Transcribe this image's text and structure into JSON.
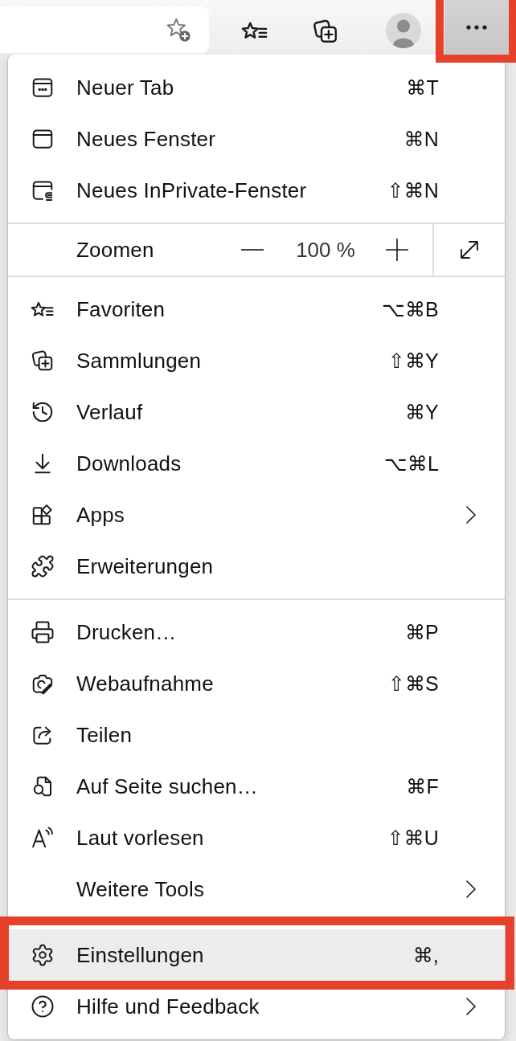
{
  "toolbar": {
    "more_button": {
      "pressed": true,
      "highlighted": true
    }
  },
  "menu": {
    "sections": [
      {
        "items": [
          {
            "kind": "command",
            "label": "Neuer Tab",
            "shortcut": "⌘T",
            "submenu": false,
            "selected": false,
            "highlighted": false
          },
          {
            "kind": "command",
            "label": "Neues Fenster",
            "shortcut": "⌘N",
            "submenu": false,
            "selected": false,
            "highlighted": false
          },
          {
            "kind": "command",
            "label": "Neues InPrivate-Fenster",
            "shortcut": "⇧⌘N",
            "submenu": false,
            "selected": false,
            "highlighted": false
          }
        ]
      },
      {
        "items": [
          {
            "kind": "zoom",
            "label": "Zoomen",
            "value": "100 %"
          }
        ]
      },
      {
        "items": [
          {
            "kind": "command",
            "label": "Favoriten",
            "shortcut": "⌥⌘B",
            "submenu": false,
            "selected": false,
            "highlighted": false
          },
          {
            "kind": "command",
            "label": "Sammlungen",
            "shortcut": "⇧⌘Y",
            "submenu": false,
            "selected": false,
            "highlighted": false
          },
          {
            "kind": "command",
            "label": "Verlauf",
            "shortcut": "⌘Y",
            "submenu": false,
            "selected": false,
            "highlighted": false
          },
          {
            "kind": "command",
            "label": "Downloads",
            "shortcut": "⌥⌘L",
            "submenu": false,
            "selected": false,
            "highlighted": false
          },
          {
            "kind": "command",
            "label": "Apps",
            "submenu": true,
            "selected": false,
            "highlighted": false
          },
          {
            "kind": "command",
            "label": "Erweiterungen",
            "submenu": false,
            "selected": false,
            "highlighted": false
          }
        ]
      },
      {
        "items": [
          {
            "kind": "command",
            "label": "Drucken…",
            "shortcut": "⌘P",
            "submenu": false,
            "selected": false,
            "highlighted": false
          },
          {
            "kind": "command",
            "label": "Webaufnahme",
            "shortcut": "⇧⌘S",
            "submenu": false,
            "selected": false,
            "highlighted": false
          },
          {
            "kind": "command",
            "label": "Teilen",
            "submenu": false,
            "selected": false,
            "highlighted": false
          },
          {
            "kind": "command",
            "label": "Auf Seite suchen…",
            "shortcut": "⌘F",
            "submenu": false,
            "selected": false,
            "highlighted": false
          },
          {
            "kind": "command",
            "label": "Laut vorlesen",
            "shortcut": "⇧⌘U",
            "submenu": false,
            "selected": false,
            "highlighted": false
          },
          {
            "kind": "command",
            "label": "Weitere Tools",
            "submenu": true,
            "selected": false,
            "highlighted": false
          }
        ]
      },
      {
        "items": [
          {
            "kind": "command",
            "label": "Einstellungen",
            "shortcut": "⌘,",
            "submenu": false,
            "selected": true,
            "highlighted": true
          },
          {
            "kind": "command",
            "label": "Hilfe und Feedback",
            "submenu": true,
            "selected": false,
            "highlighted": false
          }
        ]
      }
    ]
  }
}
